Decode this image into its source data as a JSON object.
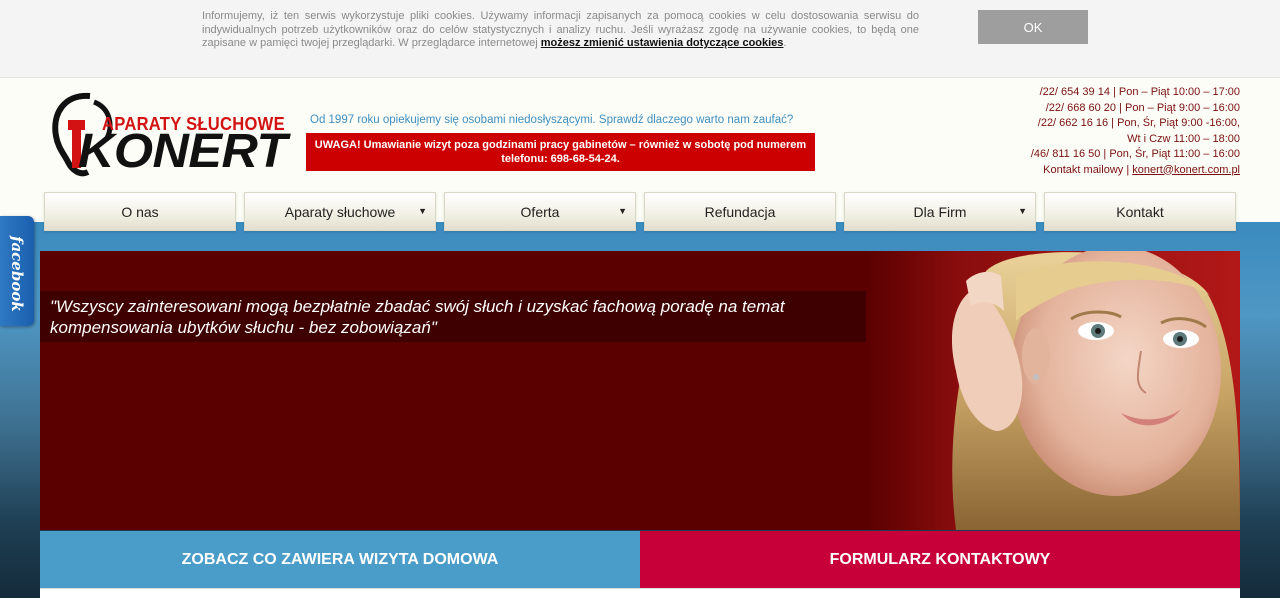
{
  "cookie": {
    "text": "Informujemy, iż ten serwis wykorzystuje pliki cookies. Używamy informacji zapisanych za pomocą cookies w celu dostosowania serwisu do indywidualnych potrzeb użytkowników oraz do celów statystycznych i analizy ruchu. Jeśli wyrażasz zgodę na używanie cookies, to będą one zapisane w pamięci twojej przeglądarki. W przeglądarce internetowej ",
    "link": "możesz zmienić ustawienia dotyczące cookies",
    "suffix": ".",
    "ok_label": "OK"
  },
  "logo": {
    "top_text": "APARATY SŁUCHOWE",
    "main_text": "KONERT"
  },
  "header": {
    "tagline": "Od 1997 roku opiekujemy się osobami niedosłyszącymi. Sprawdź dlaczego warto nam zaufać?",
    "notice": "UWAGA! Umawianie wizyt poza godzinami pracy gabinetów – również w sobotę pod numerem telefonu: 698-68-54-24."
  },
  "contacts": {
    "line1": "/22/ 654 39 14 | Pon – Piąt 10:00 – 17:00",
    "line2": "/22/ 668 60 20 | Pon – Piąt 9:00 – 16:00",
    "line3": "/22/ 662 16 16 | Pon, Śr, Piąt 9:00 -16:00,",
    "line4": "Wt i Czw 11:00 – 18:00",
    "line5": "/46/ 811 16 50 | Pon, Śr, Piąt 11:00 – 16:00",
    "mail_label": "Kontakt mailowy | ",
    "mail": "konert@konert.com.pl"
  },
  "nav": {
    "items": [
      {
        "label": "O nas"
      },
      {
        "label": "Aparaty słuchowe"
      },
      {
        "label": "Oferta"
      },
      {
        "label": "Refundacja"
      },
      {
        "label": "Dla Firm"
      },
      {
        "label": "Kontakt"
      }
    ],
    "caret": "▼"
  },
  "facebook": {
    "label": "facebook"
  },
  "banner": {
    "quote": "\"Wszyscy zainteresowani mogą bezpłatnie zbadać swój słuch i uzyskać fachową poradę na temat kompensowania ubytków słuchu - bez zobowiązań\""
  },
  "cta": {
    "visit": "ZOBACZ CO ZAWIERA WIZYTA DOMOWA",
    "form": "FORMULARZ KONTAKTOWY"
  },
  "colors": {
    "brand_red": "#cc0000",
    "banner_bg": "#5a0000",
    "cta_blue": "#4a9cc9",
    "cta_red": "#c8003a"
  }
}
